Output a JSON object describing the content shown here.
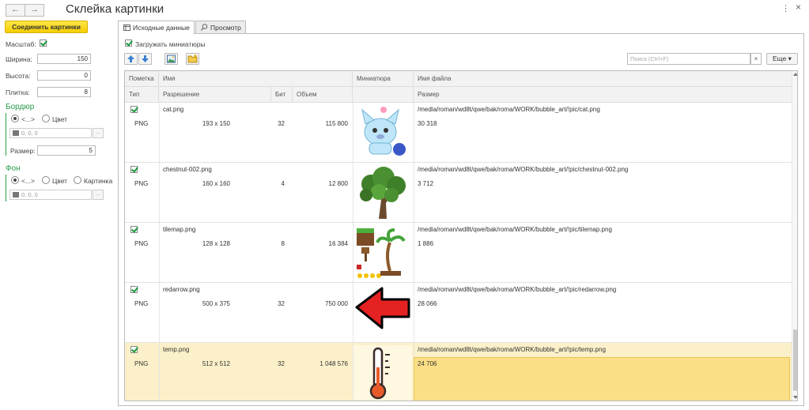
{
  "window": {
    "title": "Склейка картинки",
    "back_label": "←",
    "forward_label": "→",
    "menu_label": "⋮",
    "close_label": "×"
  },
  "left": {
    "join_button": "Соединить картинки",
    "scale_label": "Масштаб:",
    "scale_checked": true,
    "width_label": "Ширина:",
    "width_value": "150",
    "height_label": "Высота:",
    "height_value": "0",
    "tile_label": "Плитка:",
    "tile_value": "8",
    "border": {
      "title": "Бордюр",
      "option_auto": "<...>",
      "option_color": "Цвет",
      "selected": "auto",
      "color_value": "0, 0, 0",
      "ellipsis": "...",
      "size_label": "Размер:",
      "size_value": "5"
    },
    "background": {
      "title": "Фон",
      "option_auto": "<...>",
      "option_color": "Цвет",
      "option_picture": "Картинка",
      "selected": "auto",
      "color_value": "0, 0, 0",
      "ellipsis": "..."
    }
  },
  "tabs": [
    {
      "label": "Исходные данные",
      "active": true,
      "icon": "table-icon"
    },
    {
      "label": "Просмотр",
      "active": false,
      "icon": "magnifier-icon"
    }
  ],
  "main": {
    "load_thumbnails_label": "Загружать миниатюры",
    "load_thumbnails_checked": true,
    "search_placeholder": "Поиск (Ctrl+F)",
    "search_clear": "×",
    "more_label": "Еще",
    "more_arrow": "▾"
  },
  "columns": {
    "mark": "Пометка",
    "name": "Имя",
    "thumbnail": "Миниатюра",
    "filename": "Имя файла",
    "type": "Тип",
    "resolution": "Разрешение",
    "bits": "Бит",
    "volume": "Объем",
    "size": "Размер"
  },
  "rows": [
    {
      "checked": true,
      "name": "cat.png",
      "type": "PNG",
      "resolution": "193 x 150",
      "bits": "32",
      "volume": "115 800",
      "path": "/media/roman/wd8t/qwe/bak/roma/WORK/bubble_art/!pic/cat.png",
      "size": "30 318",
      "thumb": "cat-icon",
      "selected": false
    },
    {
      "checked": true,
      "name": "chestnut-002.png",
      "type": "PNG",
      "resolution": "160 x 160",
      "bits": "4",
      "volume": "12 800",
      "path": "/media/roman/wd8t/qwe/bak/roma/WORK/bubble_art/!pic/chestnut-002.png",
      "size": "3 712",
      "thumb": "tree-icon",
      "selected": false
    },
    {
      "checked": true,
      "name": "tilemap.png",
      "type": "PNG",
      "resolution": "128 x 128",
      "bits": "8",
      "volume": "16 384",
      "path": "/media/roman/wd8t/qwe/bak/roma/WORK/bubble_art/!pic/tilemap.png",
      "size": "1 886",
      "thumb": "tilemap-icon",
      "selected": false
    },
    {
      "checked": true,
      "name": "redarrow.png",
      "type": "PNG",
      "resolution": "500 x 375",
      "bits": "32",
      "volume": "750 000",
      "path": "/media/roman/wd8t/qwe/bak/roma/WORK/bubble_art/!pic/redarrow.png",
      "size": "28 066",
      "thumb": "red-arrow-icon",
      "selected": false
    },
    {
      "checked": true,
      "name": "temp.png",
      "type": "PNG",
      "resolution": "512 x 512",
      "bits": "32",
      "volume": "1 048 576",
      "path": "/media/roman/wd8t/qwe/bak/roma/WORK/bubble_art/!pic/temp.png",
      "size": "24 706",
      "thumb": "thermometer-icon",
      "selected": true
    }
  ],
  "colors": {
    "accent_yellow": "#f5cd00",
    "group_green": "#2a9d4a",
    "selected_row": "#fbf0c9",
    "selected_cell": "#fbdf86"
  }
}
